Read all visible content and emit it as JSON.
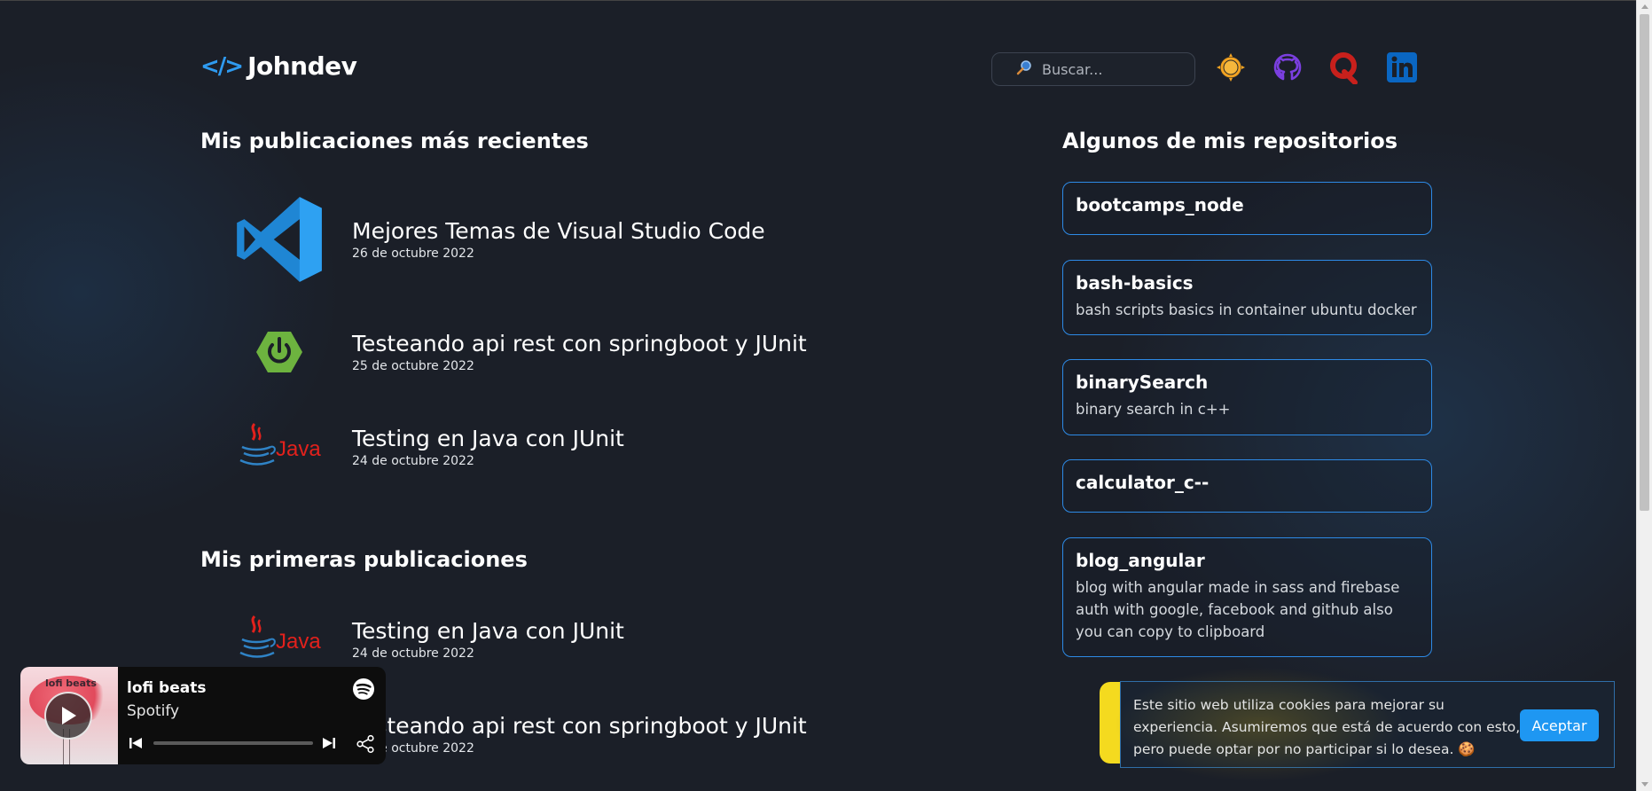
{
  "header": {
    "logo_mark": "</>",
    "logo_text": "Johndev",
    "search_placeholder": "Buscar...",
    "icons": [
      "sun-icon",
      "github-icon",
      "quora-icon",
      "linkedin-icon"
    ]
  },
  "recent": {
    "title": "Mis publicaciones más recientes",
    "posts": [
      {
        "title": "Mejores Temas de Visual Studio Code",
        "date": "26 de octubre 2022",
        "icon": "vscode-icon"
      },
      {
        "title": "Testeando api rest con springboot y JUnit",
        "date": "25 de octubre 2022",
        "icon": "spring-icon"
      },
      {
        "title": "Testing en Java con JUnit",
        "date": "24 de octubre 2022",
        "icon": "java-icon"
      }
    ]
  },
  "first": {
    "title": "Mis primeras publicaciones",
    "posts": [
      {
        "title": "Testing en Java con JUnit",
        "date": "24 de octubre 2022",
        "icon": "java-icon"
      },
      {
        "title": "Testeando api rest con springboot y JUnit",
        "date": "25 de octubre 2022",
        "icon": "spring-icon"
      }
    ]
  },
  "repos": {
    "title": "Algunos de mis repositorios",
    "items": [
      {
        "name": "bootcamps_node",
        "desc": ""
      },
      {
        "name": "bash-basics",
        "desc": "bash scripts basics in container ubuntu docker"
      },
      {
        "name": "binarySearch",
        "desc": "binary search in c++"
      },
      {
        "name": "calculator_c--",
        "desc": ""
      },
      {
        "name": "blog_angular",
        "desc": "blog with angular made in sass and firebase auth with google, facebook and github also you can copy to clipboard"
      }
    ]
  },
  "spotify": {
    "art_title": "lofi beats",
    "title": "lofi beats",
    "artist": "Spotify",
    "progress": 0
  },
  "cookie": {
    "text": "Este sitio web utiliza cookies para mejorar su experiencia. Asumiremos que está de acuerdo con esto, pero puede optar por no participar si lo desea. 🍪",
    "button": "Aceptar"
  },
  "colors": {
    "background": "#1b1f28",
    "accent": "#2f9bf0",
    "repo_border": "#2d8ae6",
    "cookie_accent": "#f4da1f",
    "button": "#1e97f2"
  }
}
